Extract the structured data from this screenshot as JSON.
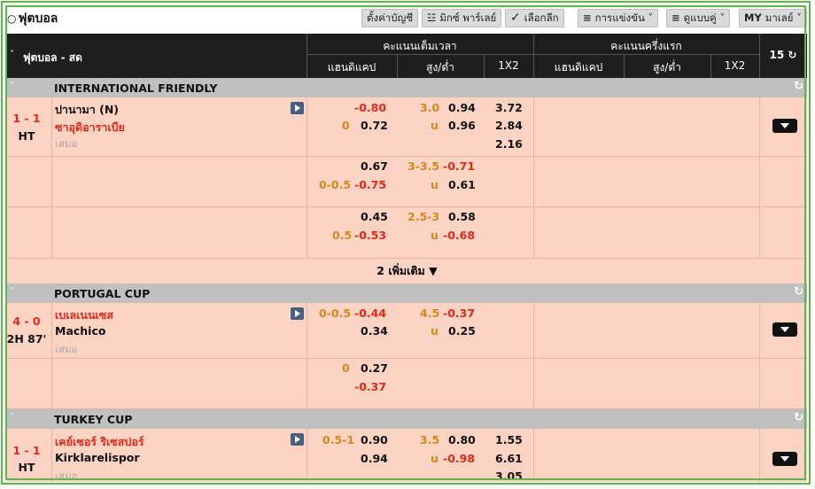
{
  "topbar": {
    "title": "ฟุตบอล",
    "buttons": [
      {
        "label": "ตั้งค่าบัญชี",
        "icon": ""
      },
      {
        "label": "มิกซ์ พาร์เลย์",
        "icon": "parlay-icon"
      },
      {
        "label": "เลือกลีก",
        "icon": "check-icon"
      },
      {
        "label": "การแข่งขัน",
        "icon": "list-icon"
      },
      {
        "label": "ดูแบบคู่",
        "icon": "list-icon"
      },
      {
        "label": "มาเลย์",
        "icon": "MY"
      }
    ]
  },
  "header": {
    "section_title": "ฟุตบอล - สด",
    "full_time": "คะแนนเต็มเวลา",
    "first_half": "คะแนนครึ่งแรก",
    "col_handicap": "แฮนดิแคป",
    "col_ou": "สูง/ต่ำ",
    "col_1x2": "1X2",
    "refresh_count": "15"
  },
  "leagues": [
    {
      "name": "INTERNATIONAL FRIENDLY",
      "match": {
        "score": "1 - 1",
        "time": "HT",
        "home": "ปานามา (N)",
        "away": "ซาอุดิอาราเบีย",
        "draw": "เสมอ",
        "lines": [
          {
            "hdp_line": "",
            "hdp_home": "-0.80",
            "hdp_away_line": "0",
            "hdp_away": "0.72",
            "ou_line": "3.0",
            "ou_over": "0.94",
            "ou_u": "u",
            "ou_under": "0.96",
            "x1": "3.72",
            "x2": "2.84",
            "xd": "2.16"
          },
          {
            "hdp_line": "",
            "hdp_home": "0.67",
            "hdp_away_line": "0-0.5",
            "hdp_away": "-0.75",
            "ou_line": "3-3.5",
            "ou_over": "-0.71",
            "ou_u": "u",
            "ou_under": "0.61"
          },
          {
            "hdp_line": "",
            "hdp_home": "0.45",
            "hdp_away_line": "0.5",
            "hdp_away": "-0.53",
            "ou_line": "2.5-3",
            "ou_over": "0.58",
            "ou_u": "u",
            "ou_under": "-0.68"
          }
        ]
      },
      "more": "2 เพิ่มเติม ▼"
    },
    {
      "name": "PORTUGAL CUP",
      "match": {
        "score": "4 - 0",
        "time": "2H 87'",
        "home": "เบเลเนนเซส",
        "away": "Machico",
        "draw": "เสมอ",
        "lines": [
          {
            "hdp_line": "0-0.5",
            "hdp_home": "-0.44",
            "hdp_away": "0.34",
            "ou_line": "4.5",
            "ou_over": "-0.37",
            "ou_u": "u",
            "ou_under": "0.25"
          },
          {
            "hdp_line": "0",
            "hdp_home": "0.27",
            "hdp_away": "-0.37"
          }
        ]
      }
    },
    {
      "name": "TURKEY CUP",
      "match": {
        "score": "1 - 1",
        "time": "HT",
        "home": "เคย์เซอร์ ริเซสปอร์",
        "away": "Kirklarelispor",
        "draw": "เสมอ",
        "lines": [
          {
            "hdp_line": "0.5-1",
            "hdp_home": "0.90",
            "hdp_away": "0.94",
            "ou_line": "3.5",
            "ou_over": "0.80",
            "ou_u": "u",
            "ou_under": "-0.98",
            "x1": "1.55",
            "x2": "6.61",
            "xd": "3.05"
          }
        ]
      }
    }
  ]
}
